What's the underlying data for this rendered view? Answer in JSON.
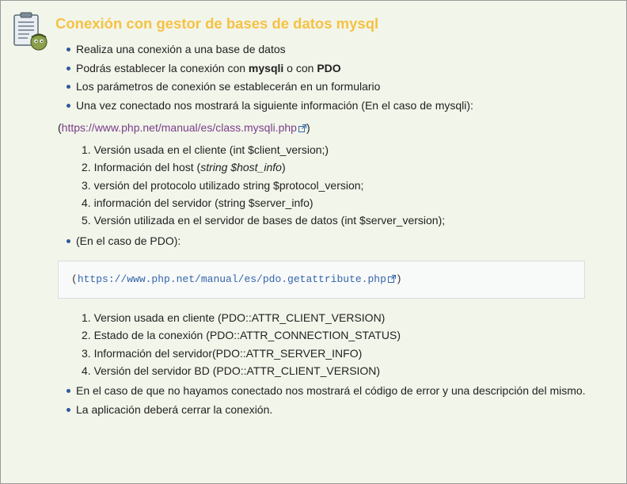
{
  "title": "Conexión con gestor de bases de datos mysql",
  "icon": "clipboard-checklist-icon",
  "intro_bullets": [
    {
      "pre": "Realiza una conexión a una base de datos"
    },
    {
      "pre": "Podrás establecer la conexión con ",
      "b1": "mysqli",
      "mid": " o con ",
      "b2": "PDO"
    },
    {
      "pre": "Los parámetros de conexión se establecerán en un formulario"
    },
    {
      "pre": "Una vez conectado nos mostrará la siguiente información (En el caso de mysqli):"
    }
  ],
  "mysqli_ref": {
    "open": "(",
    "url": "https://www.php.net/manual/es/class.mysqli.php",
    "close": ")"
  },
  "mysqli_items": [
    {
      "num": "1.",
      "text": "Versión usada en el cliente (int $client_version;)"
    },
    {
      "num": "2.",
      "text_pre": "Información del host (",
      "text_em": "string $host_info",
      "text_post": ")"
    },
    {
      "num": "3.",
      "text": "versión del protocolo utilizado string $protocol_version;"
    },
    {
      "num": "4.",
      "text": "información del servidor (string $server_info)"
    },
    {
      "num": "5.",
      "text": "Versión utilizada en el servidor de bases de datos (int $server_version);"
    }
  ],
  "pdo_bullet": "(En el caso de PDO):",
  "pdo_ref": {
    "open": "(",
    "url": "https://www.php.net/manual/es/pdo.getattribute.php",
    "close": ")"
  },
  "pdo_items": [
    {
      "num": "1.",
      "text": "Version usada en cliente (PDO::ATTR_CLIENT_VERSION)"
    },
    {
      "num": "2.",
      "text": "Estado de la conexión (PDO::ATTR_CONNECTION_STATUS)"
    },
    {
      "num": "3.",
      "text": "Información del servidor(PDO::ATTR_SERVER_INFO)"
    },
    {
      "num": "4.",
      "text": "Versión del servidor BD (PDO::ATTR_CLIENT_VERSION)"
    }
  ],
  "final_bullets": [
    "En el caso de que no hayamos conectado nos mostrará el código de error y una descripción del mismo.",
    "La aplicación deberá cerrar la conexión."
  ],
  "colors": {
    "title": "#f5c244",
    "bullet": "#2d5a9c",
    "link": "#7b3f8c",
    "code_link": "#3366aa",
    "background": "#f2f5ea"
  }
}
